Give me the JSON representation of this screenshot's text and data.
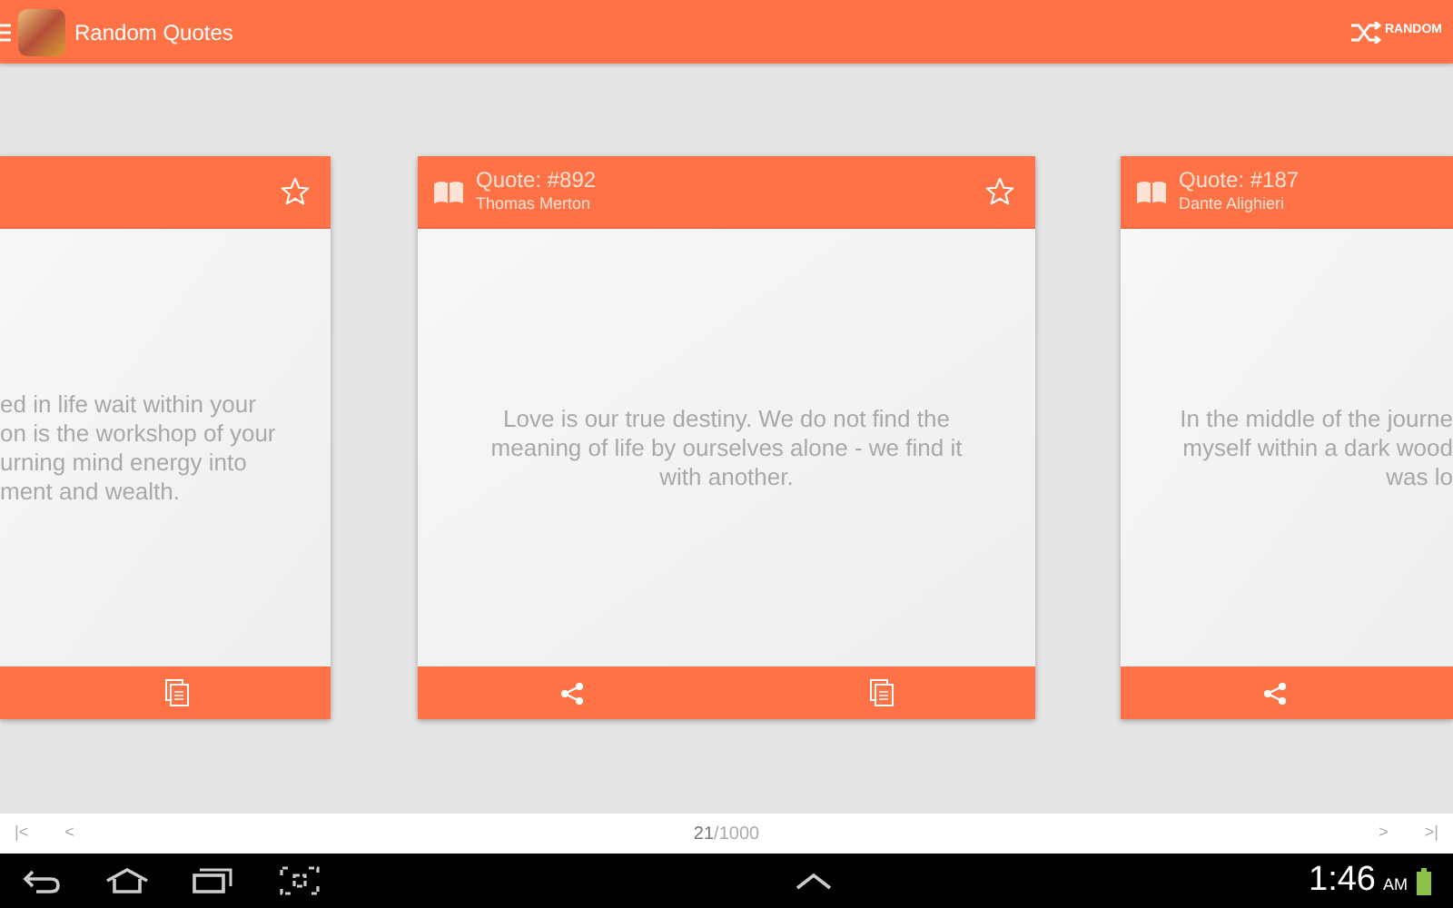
{
  "app_bar": {
    "title": "Random Quotes",
    "action_label": "RANDOM"
  },
  "cards": [
    {
      "kind": "clipped-left",
      "starred": false,
      "text_lines": [
        "ed in life wait within your",
        "on is the workshop of your",
        "urning mind energy into",
        "ment and wealth."
      ],
      "actions": [
        {
          "kind": "copy"
        }
      ]
    },
    {
      "kind": "full",
      "title": "Quote: #892",
      "author": "Thomas Merton",
      "starred": false,
      "text_lines": [
        "Love is our true destiny. We do not find the meaning of life by ourselves alone - we find it with another."
      ],
      "actions": [
        {
          "kind": "share"
        },
        {
          "kind": "copy"
        }
      ]
    },
    {
      "kind": "clipped-right",
      "title": "Quote: #187",
      "author": "Dante Alighieri",
      "text_lines": [
        "In the middle of the journe",
        "myself within a dark wood",
        "was lo"
      ],
      "actions": [
        {
          "kind": "share"
        }
      ]
    }
  ],
  "pager": {
    "first": "|<",
    "prev": "<",
    "current": "21",
    "total": "/1000",
    "next": ">",
    "last": ">|"
  },
  "status": {
    "time": "1:46",
    "meridiem": "AM"
  }
}
